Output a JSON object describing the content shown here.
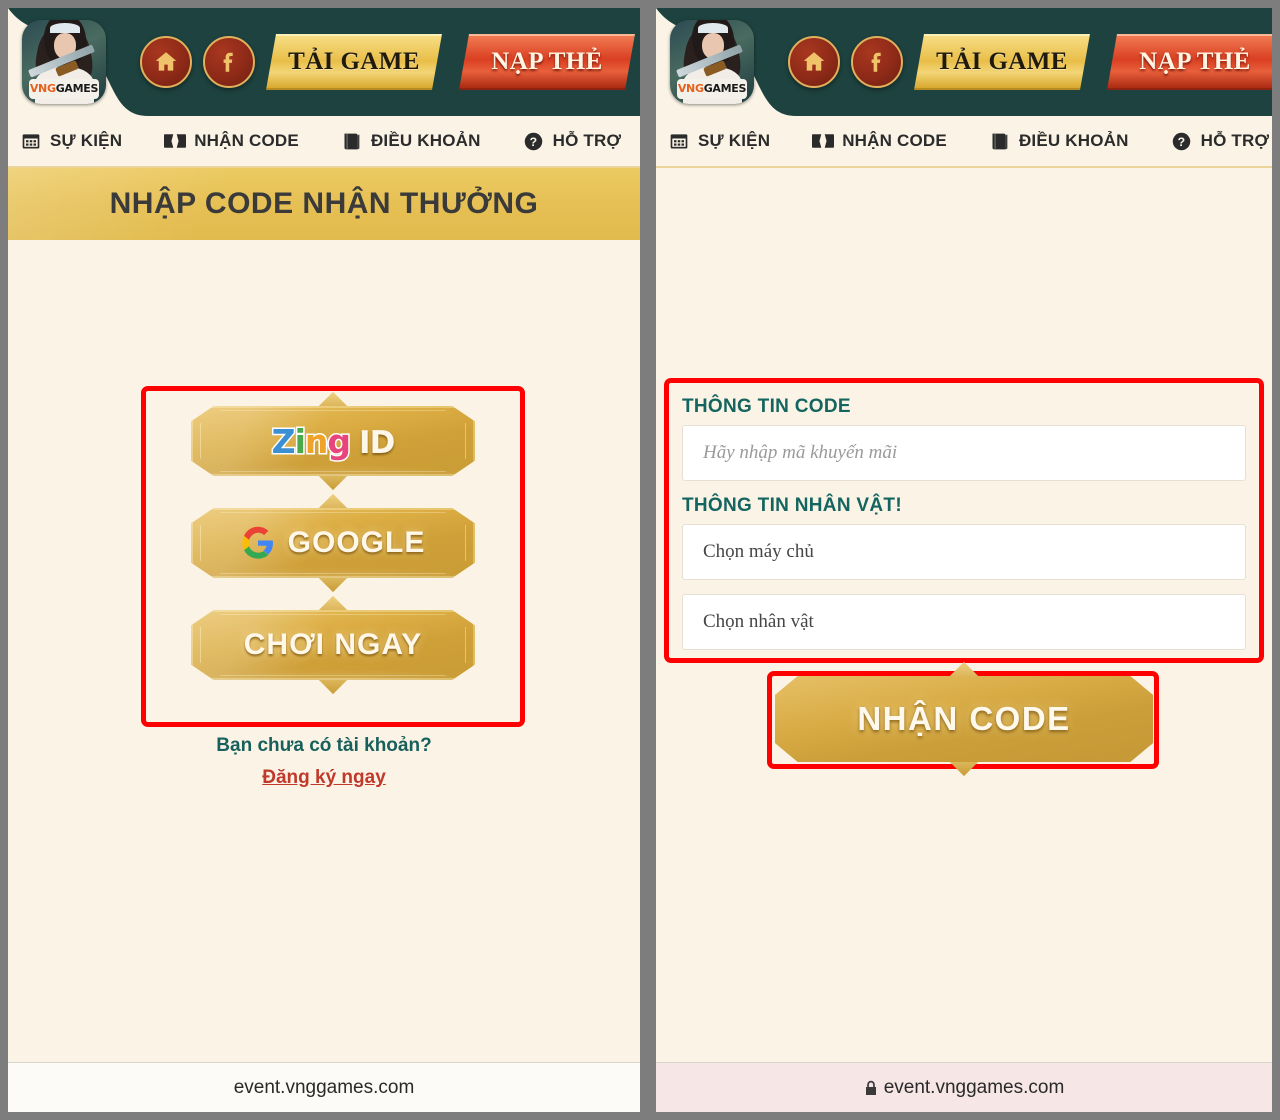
{
  "header": {
    "logo_alt": "VNGGAMES",
    "logo_text_vng": "VNG",
    "logo_text_games": "GAMES",
    "home_icon": "home-icon",
    "facebook_icon": "facebook-icon",
    "download_label": "TẢI GAME",
    "topup_label": "NẠP THẺ"
  },
  "nav": {
    "items": [
      {
        "label": "SỰ KIỆN",
        "icon": "calendar-icon"
      },
      {
        "label": "NHẬN CODE",
        "icon": "ticket-icon"
      },
      {
        "label": "ĐIỀU KHOẢN",
        "icon": "book-icon"
      },
      {
        "label": "HỖ TRỢ",
        "icon": "question-circle-icon"
      }
    ]
  },
  "left_panel": {
    "banner_title": "NHẬP CODE NHẬN THƯỞNG",
    "login_buttons": [
      {
        "id": "zing-id",
        "type": "logo",
        "label": "Zing ID",
        "letters": [
          "Z",
          "i",
          "n",
          "g"
        ],
        "suffix": "ID"
      },
      {
        "id": "google",
        "type": "icon-text",
        "label": "GOOGLE",
        "icon": "google-g-icon"
      },
      {
        "id": "play-now",
        "type": "text",
        "label": "CHƠI NGAY"
      }
    ],
    "no_account_text": "Bạn chưa có tài khoản?",
    "register_link": "Đăng ký ngay",
    "footer_url": "event.vnggames.com"
  },
  "right_panel": {
    "code_section_label": "THÔNG TIN CODE",
    "code_input_placeholder": "Hãy nhập mã khuyến mãi",
    "code_input_value": "",
    "character_section_label": "THÔNG TIN NHÂN VẬT!",
    "server_select_value": "Chọn máy chủ",
    "character_select_value": "Chọn nhân vật",
    "submit_label": "NHẬN CODE",
    "footer_url": "event.vnggames.com",
    "footer_lock_icon": "lock-icon"
  },
  "colors": {
    "page_bg": "#7d7d7d",
    "panel_bg": "#fbf4e6",
    "header_dark": "#1d423f",
    "banner_gold": "#e6c054",
    "gold_button": "#d8ab45",
    "red_accent": "#da3f22",
    "annotation_red": "#ff0000",
    "label_teal": "#14655f",
    "link_red": "#c0392b"
  }
}
